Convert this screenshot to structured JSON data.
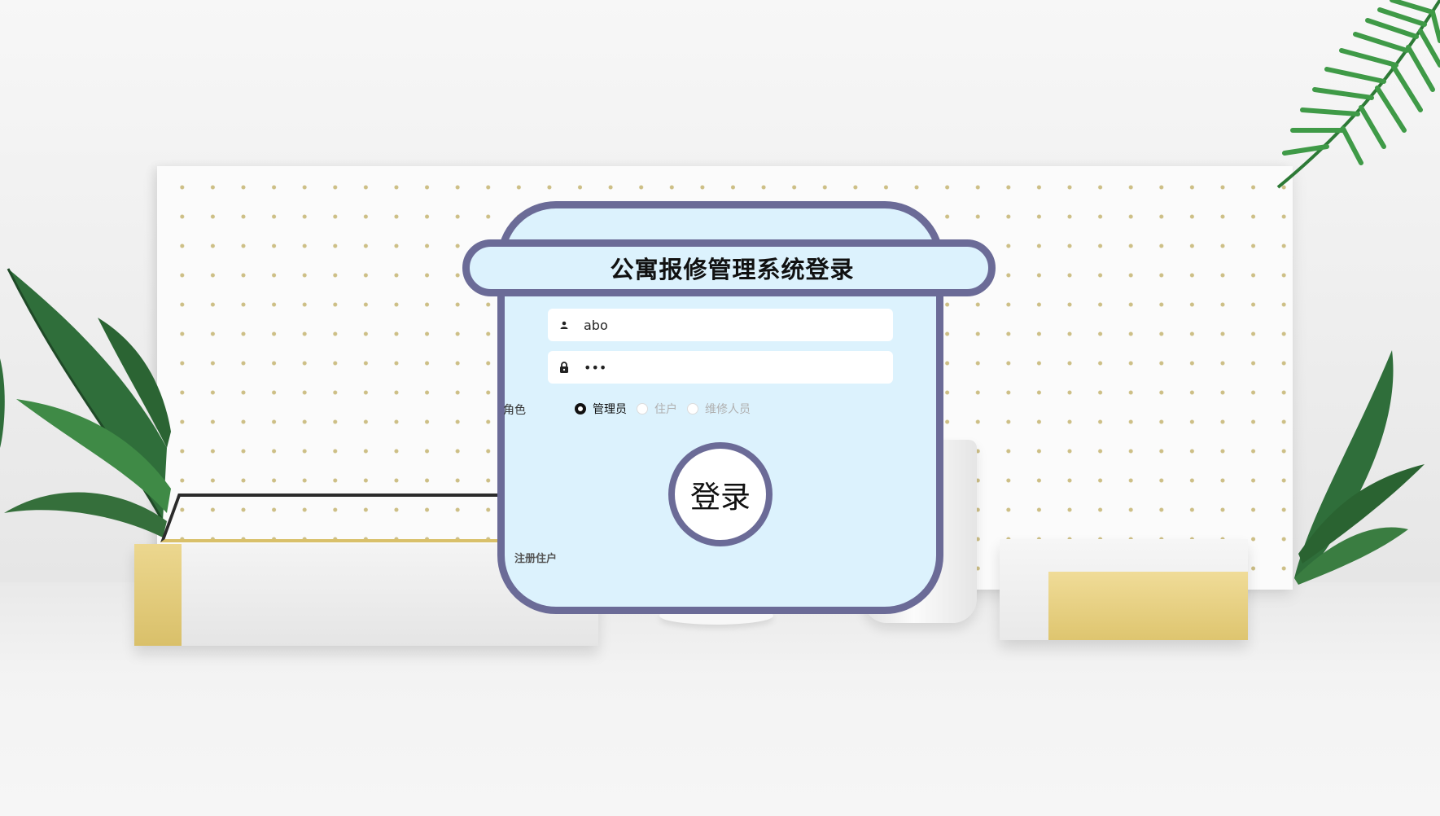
{
  "login": {
    "title": "公寓报修管理系统登录",
    "username": {
      "value": "abo",
      "icon": "user-icon"
    },
    "password": {
      "value": "123",
      "icon": "lock-icon"
    },
    "role_label": "角色",
    "roles": [
      {
        "label": "管理员",
        "checked": true
      },
      {
        "label": "住户",
        "checked": false
      },
      {
        "label": "维修人员",
        "checked": false
      }
    ],
    "submit_label": "登录",
    "register_label": "注册住户"
  },
  "colors": {
    "card_bg": "#dcf2fd",
    "card_border": "#6b6b97",
    "accent_gold": "#d9c06a"
  }
}
